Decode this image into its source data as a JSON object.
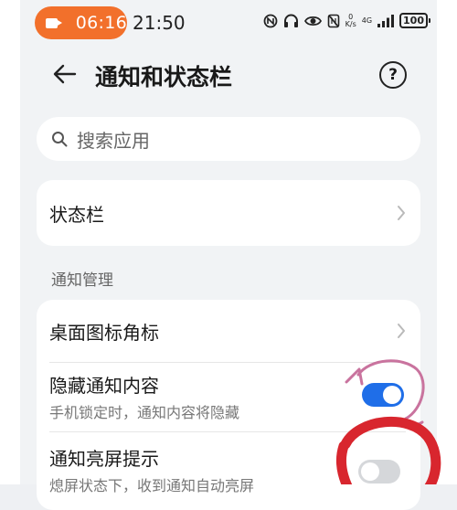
{
  "status_bar": {
    "pill_time": "06:16",
    "clock": "21:50",
    "speed_top": "0",
    "speed_unit": "K/s",
    "network": "4G",
    "battery": "100"
  },
  "header": {
    "title": "通知和状态栏"
  },
  "search": {
    "placeholder": "搜索应用"
  },
  "status_bar_item": {
    "label": "状态栏"
  },
  "notification_section": {
    "header": "通知管理",
    "items": [
      {
        "label": "桌面图标角标"
      },
      {
        "label": "隐藏通知内容",
        "description": "手机锁定时，通知内容将隐藏",
        "enabled": true
      },
      {
        "label": "通知亮屏提示",
        "description": "熄屏状态下，收到通知自动亮屏",
        "enabled": false
      }
    ]
  },
  "colors": {
    "accent": "#1f6ee8",
    "pill": "#f2702b",
    "annotation_red": "#d8262e",
    "annotation_pink": "#c9739e"
  }
}
